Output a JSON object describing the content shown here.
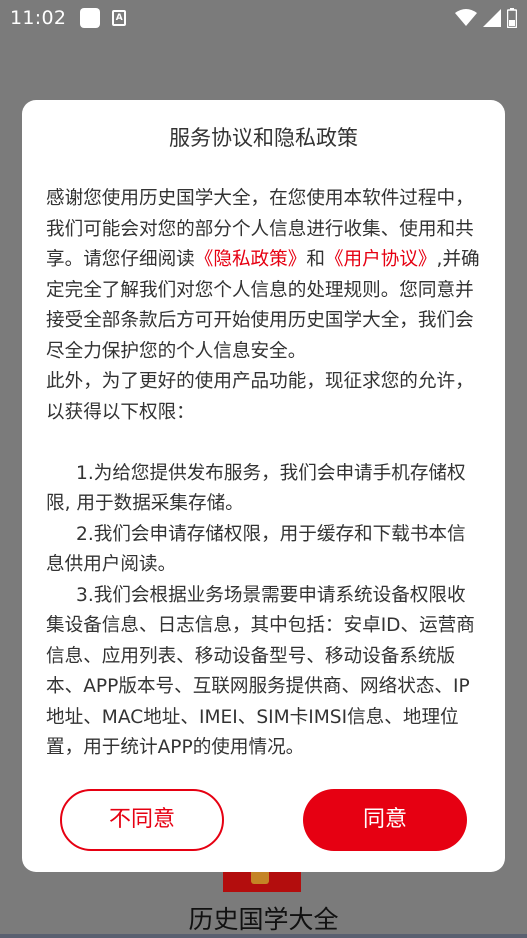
{
  "status_bar": {
    "time": "11:02",
    "icons": [
      "notification-square-icon",
      "font-a-icon",
      "wifi-icon",
      "signal-icon",
      "battery-icon"
    ]
  },
  "background_app": {
    "title": "历史国学大全"
  },
  "dialog": {
    "title": "服务协议和隐私政策",
    "intro_part1": "感谢您使用历史国学大全，在您使用本软件过程中，我们可能会对您的部分个人信息进行收集、使用和共享。请您仔细阅读",
    "privacy_link": "《隐私政策》",
    "and_text": "和",
    "user_agreement_link": "《用户协议》",
    "intro_part2": ",并确定完全了解我们对您个人信息的处理规则。您同意并接受全部条款后方可开始使用历史国学大全，我们会尽全力保护您的个人信息安全。",
    "permission_intro": "此外，为了更好的使用产品功能，现征求您的允许，以获得以下权限：",
    "item1": "1.为给您提供发布服务，我们会申请手机存储权限, 用于数据采集存储。",
    "item2": "2.我们会申请存储权限，用于缓存和下载书本信息供用户阅读。",
    "item3": "3.我们会根据业务场景需要申请系统设备权限收集设备信息、日志信息，其中包括：安卓ID、运营商信息、应用列表、移动设备型号、移动设备系统版本、APP版本号、互联网服务提供商、网络状态、IP地址、MAC地址、IMEI、SIM卡IMSI信息、地理位置，用于统计APP的使用情况。",
    "disagree_label": "不同意",
    "agree_label": "同意"
  },
  "colors": {
    "accent": "#e60012",
    "overlay": "#7b7b7b",
    "dialog_bg": "#ffffff",
    "text": "#333333"
  }
}
